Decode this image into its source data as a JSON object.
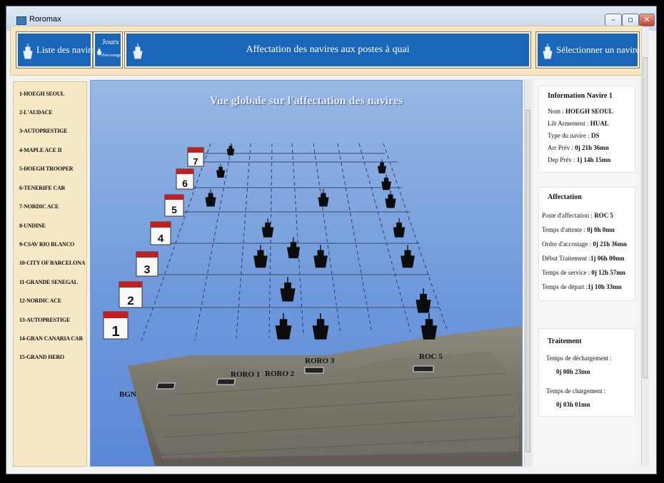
{
  "window": {
    "title": "Roromax"
  },
  "toolbar": {
    "vessels_list_label": "Liste des navires",
    "berth_days_label_1": "Jours",
    "berth_days_label_2": "d'accostage",
    "header_title": "Affectation des navires aux postes à quai",
    "select_vessel_label": "Sélectionner un navire"
  },
  "vessels": [
    "1-HOEGH SEOUL",
    "2-L'AUDACE",
    "3-AUTOPRESTIGE",
    "4-MAPLE ACE II",
    "5-HOEGH TROOPER",
    "6-TENERIFE CAR",
    "7-NORDIC ACE",
    "8-UNDINE",
    "9-CSAV RIO BLANCO",
    "10-CITY OF BARCELONA",
    "11-GRANDE SENEGAL",
    "12-NORDIC ACE",
    "13-AUTOPRESTIGE",
    "14-GRAN CANARIA CAR",
    "15-GRAND HERO"
  ],
  "map": {
    "title": "Vue globale sur l'affectation des navires",
    "days": [
      "1",
      "2",
      "3",
      "4",
      "5",
      "6",
      "7"
    ],
    "berths": [
      "BGN",
      "RORO 1",
      "RORO 2",
      "RORO 3",
      "ROC 5"
    ]
  },
  "info": {
    "title": "Information Navire 1",
    "name_label": "Nom :",
    "name_value": "HOEGH SEOUL",
    "armement_label": "Lib Armement :",
    "armement_value": "HUAL",
    "type_label": "Type du navire :",
    "type_value": "DS",
    "arr_label": "Arr Prév :",
    "arr_value": "0j 21h 36mn",
    "dep_label": "Dep Prév :",
    "dep_value": "1j 14h 15mn"
  },
  "affectation": {
    "title": "Affectation",
    "poste_label": "Poste d'affectation :",
    "poste_value": "ROC 5",
    "attente_label": "Temps d'attente :",
    "attente_value": "0j 0h 0mn",
    "ordre_label": "Ordre d'accostage :",
    "ordre_value": "0j 21h 36mn",
    "debut_label": "Début Traitement :",
    "debut_value": "1j 06h 00mn",
    "service_label": "Temps de service :",
    "service_value": "0j 12h 57mn",
    "depart_label": "Temps de départ :",
    "depart_value": "1j 10h 33mn"
  },
  "traitement": {
    "title": "Traitement",
    "dechargement_label": "Temps de déchargement :",
    "dechargement_value": "0j 00h 23mn",
    "chargement_label": "Temps de chargement :",
    "chargement_value": "0j 03h 01mn"
  }
}
